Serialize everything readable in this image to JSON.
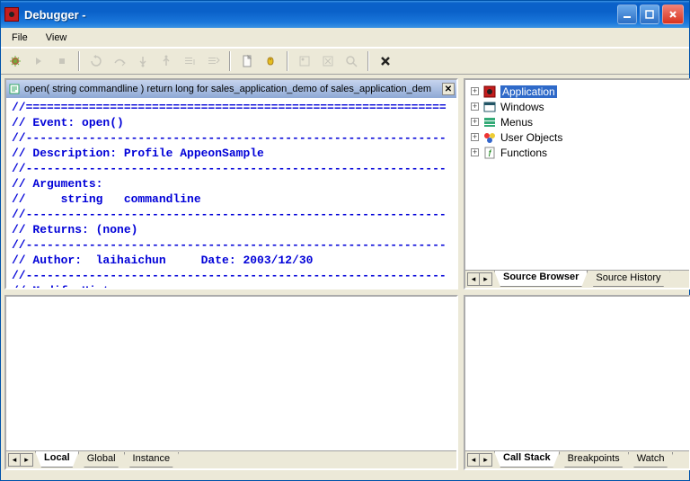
{
  "window": {
    "title": "Debugger -"
  },
  "menu": {
    "file": "File",
    "view": "View"
  },
  "source_tab": {
    "header": "open( string commandline  ) return long for sales_application_demo of sales_application_dem"
  },
  "code_lines": [
    "//============================================================",
    "// Event: open()",
    "//------------------------------------------------------------",
    "// Description: Profile AppeonSample",
    "//------------------------------------------------------------",
    "// Arguments:",
    "//     string   commandline",
    "//------------------------------------------------------------",
    "// Returns: (none)",
    "//------------------------------------------------------------",
    "// Author:  laihaichun     Date: 2003/12/30",
    "//------------------------------------------------------------",
    "// Modify History:"
  ],
  "tree": {
    "items": [
      {
        "label": "Application",
        "selected": true,
        "icon": "app"
      },
      {
        "label": "Windows",
        "selected": false,
        "icon": "win"
      },
      {
        "label": "Menus",
        "selected": false,
        "icon": "menu"
      },
      {
        "label": "User Objects",
        "selected": false,
        "icon": "uobj"
      },
      {
        "label": "Functions",
        "selected": false,
        "icon": "func"
      }
    ]
  },
  "tabs": {
    "source_browser": "Source Browser",
    "source_history": "Source History",
    "local": "Local",
    "global": "Global",
    "instance": "Instance",
    "call_stack": "Call Stack",
    "breakpoints": "Breakpoints",
    "watch": "Watch"
  }
}
